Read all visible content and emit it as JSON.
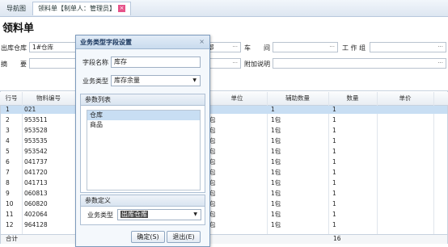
{
  "tabs": [
    {
      "label": "导航图"
    },
    {
      "label": "领料单【制单人：管理员】"
    }
  ],
  "page_title": "领料单",
  "form": {
    "warehouse_label": "出库仓库",
    "warehouse_value": "1#仓库",
    "dept_value": "部",
    "workshop_label": "车　　间",
    "team_label": "工 作 组",
    "summary_label": "摘　　要",
    "extra_label": "附加说明"
  },
  "grid": {
    "headers": [
      "行号",
      "物料编号",
      "单位",
      "辅助数量",
      "数量",
      "单价"
    ],
    "rows": [
      {
        "no": "1",
        "code": "021",
        "unit": "",
        "aux": "1",
        "qty": "1"
      },
      {
        "no": "2",
        "code": "953511",
        "unit": "包",
        "aux": "1包",
        "qty": "1"
      },
      {
        "no": "3",
        "code": "953528",
        "unit": "包",
        "aux": "1包",
        "qty": "1"
      },
      {
        "no": "4",
        "code": "953535",
        "unit": "包",
        "aux": "1包",
        "qty": "1"
      },
      {
        "no": "5",
        "code": "953542",
        "unit": "包",
        "aux": "1包",
        "qty": "1"
      },
      {
        "no": "6",
        "code": "041737",
        "unit": "包",
        "aux": "1包",
        "qty": "1"
      },
      {
        "no": "7",
        "code": "041720",
        "unit": "包",
        "aux": "1包",
        "qty": "1"
      },
      {
        "no": "8",
        "code": "041713",
        "unit": "包",
        "aux": "1包",
        "qty": "1"
      },
      {
        "no": "9",
        "code": "060813",
        "unit": "包",
        "aux": "1包",
        "qty": "1"
      },
      {
        "no": "10",
        "code": "060820",
        "unit": "包",
        "aux": "1包",
        "qty": "1"
      },
      {
        "no": "11",
        "code": "402064",
        "unit": "包",
        "aux": "1包",
        "qty": "1"
      },
      {
        "no": "12",
        "code": "964128",
        "unit": "包",
        "aux": "1包",
        "qty": "1"
      }
    ],
    "total_label": "合计",
    "total_qty": "16"
  },
  "dialog": {
    "title": "业务类型字段设置",
    "close": "×",
    "field_name_label": "字段名称",
    "field_name_value": "库存",
    "biz_type_label": "业务类型",
    "biz_type_value": "库存余量",
    "param_list_label": "参数列表",
    "params": [
      "仓库",
      "商品"
    ],
    "param_def_label": "参数定义",
    "param_biz_label": "业务类型",
    "param_biz_value": "出库仓库",
    "ok_label": "确定(S)",
    "exit_label": "退出(E)"
  },
  "colors": {
    "selected_row": "#c8def3",
    "dialog_bg": "#f4f8fc",
    "dialog_border": "#7d9bbd",
    "highlight": "#4a4a4a"
  }
}
